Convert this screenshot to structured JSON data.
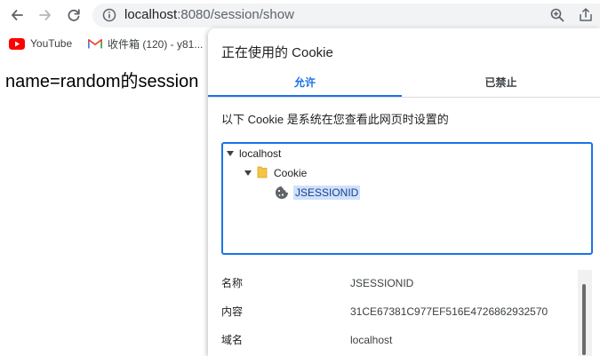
{
  "browser": {
    "url_host": "localhost",
    "url_rest": ":8080/session/show",
    "bookmarks": [
      {
        "label": "YouTube",
        "icon": "youtube-icon"
      },
      {
        "label": "收件箱 (120) - y81...",
        "icon": "gmail-icon"
      }
    ]
  },
  "page": {
    "text": "name=random的session"
  },
  "cookie_dialog": {
    "title": "正在使用的 Cookie",
    "tabs": [
      {
        "label": "允许",
        "selected": true
      },
      {
        "label": "已禁止",
        "selected": false
      }
    ],
    "description": "以下 Cookie 是系统在您查看此网页时设置的",
    "tree": {
      "site": "localhost",
      "folder": "Cookie",
      "cookie": "JSESSIONID"
    },
    "details": [
      {
        "label": "名称",
        "value": "JSESSIONID"
      },
      {
        "label": "内容",
        "value": "31CE67381C977EF516E4726862932570"
      },
      {
        "label": "域名",
        "value": "localhost"
      }
    ]
  },
  "colors": {
    "accent": "#1a73e8",
    "selection": "#cfe1fc",
    "youtube_red": "#ff0000"
  }
}
